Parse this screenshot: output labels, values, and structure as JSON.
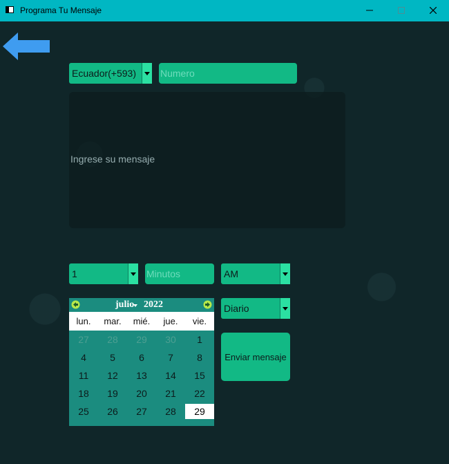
{
  "window": {
    "title": "Programa Tu Mensaje"
  },
  "form": {
    "country_value": "Ecuador(+593)",
    "number_placeholder": "Numero",
    "message_placeholder": "Ingrese su mensaje",
    "hour_value": "1",
    "minutes_placeholder": "Minutos",
    "ampm_value": "AM",
    "frequency_value": "Diario",
    "send_label": "Enviar mensaje"
  },
  "calendar": {
    "month": "julio",
    "year": "2022",
    "weekdays": [
      "lun.",
      "mar.",
      "mié.",
      "jue.",
      "vie."
    ],
    "rows": [
      [
        "27",
        "28",
        "29",
        "30",
        "1"
      ],
      [
        "4",
        "5",
        "6",
        "7",
        "8"
      ],
      [
        "11",
        "12",
        "13",
        "14",
        "15"
      ],
      [
        "18",
        "19",
        "20",
        "21",
        "22"
      ],
      [
        "25",
        "26",
        "27",
        "28",
        "29"
      ]
    ],
    "selected_day": "29"
  },
  "colors": {
    "accent": "#12b985",
    "titlebar": "#00b7c3",
    "background": "#102629",
    "arrow": "#3f9cf0"
  }
}
